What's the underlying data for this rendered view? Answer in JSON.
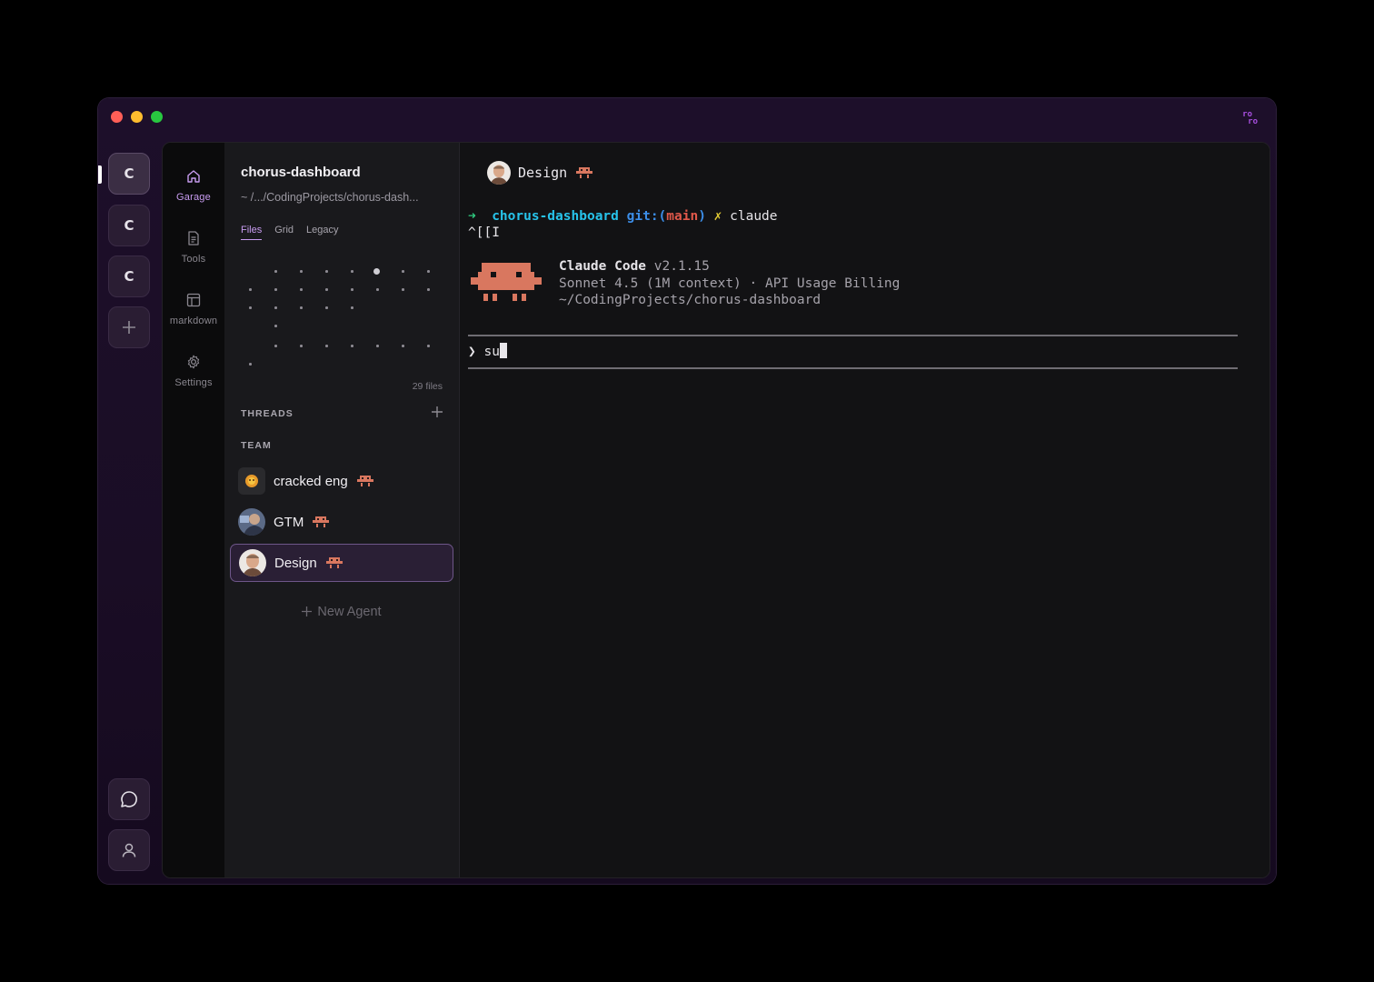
{
  "window": {
    "brand_line1": "ro",
    "brand_line2": "ro"
  },
  "workspaces": {
    "items": [
      {
        "label": "C",
        "active": true
      },
      {
        "label": "C",
        "active": false
      },
      {
        "label": "C",
        "active": false
      }
    ],
    "add_icon": "plus-icon",
    "bottom_icons": [
      "chat-bubble-icon",
      "user-icon"
    ]
  },
  "nav": {
    "items": [
      {
        "label": "Garage",
        "icon": "home-icon",
        "active": true
      },
      {
        "label": "Tools",
        "icon": "document-icon",
        "active": false
      },
      {
        "label": "markdown",
        "icon": "layout-icon",
        "active": false
      },
      {
        "label": "Settings",
        "icon": "gear-icon",
        "active": false
      }
    ]
  },
  "project": {
    "title": "chorus-dashboard",
    "path": "~ /.../CodingProjects/chorus-dash...",
    "tabs": [
      {
        "label": "Files",
        "active": true
      },
      {
        "label": "Grid",
        "active": false
      },
      {
        "label": "Legacy",
        "active": false
      }
    ],
    "files_count": "29 files"
  },
  "threads": {
    "label": "THREADS"
  },
  "team": {
    "label": "TEAM",
    "agents": [
      {
        "name": "cracked eng",
        "selected": false
      },
      {
        "name": "GTM",
        "selected": false
      },
      {
        "name": "Design",
        "selected": true
      }
    ],
    "new_agent_label": "New Agent"
  },
  "terminal": {
    "header_title": "Design",
    "prompt_arrow": "➜",
    "dir": "chorus-dashboard",
    "git_prefix": "git:(",
    "branch": "main",
    "git_suffix": ")",
    "dirty_mark": "✗",
    "command": "claude",
    "escape_line": "^[[I",
    "app_name": "Claude Code",
    "app_version": "v2.1.15",
    "model_line": "Sonnet 4.5 (1M context) · API Usage Billing",
    "cwd_line": "~/CodingProjects/chorus-dashboard",
    "input_prompt": "❯",
    "input_value": "su"
  },
  "colors": {
    "accent": "#c89cf0",
    "bot": "#d9775f"
  }
}
